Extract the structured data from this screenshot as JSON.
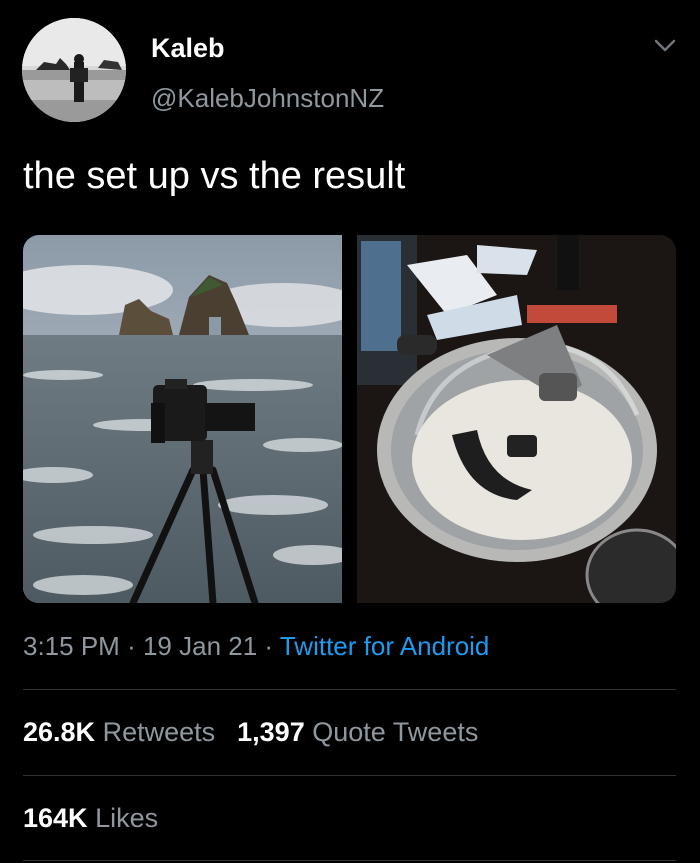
{
  "tweet": {
    "display_name": "Kaleb",
    "handle": "@KalebJohnstonNZ",
    "text": "the set up vs the result",
    "time": "3:15 PM",
    "date": "19 Jan 21",
    "source": "Twitter for Android",
    "separator": "·"
  },
  "stats": {
    "retweets_count": "26.8K",
    "retweets_label": "Retweets",
    "quote_count": "1,397",
    "quote_label": "Quote Tweets",
    "likes_count": "164K",
    "likes_label": "Likes"
  },
  "media": {
    "photo_1": "tripod camera on beach",
    "photo_2": "camera in pot of rice"
  },
  "icons": {
    "menu": "chevron-down-icon"
  },
  "colors": {
    "background": "#000000",
    "secondary_text": "#8f979f",
    "link": "#1d9bf0",
    "divider": "#2f3336"
  }
}
